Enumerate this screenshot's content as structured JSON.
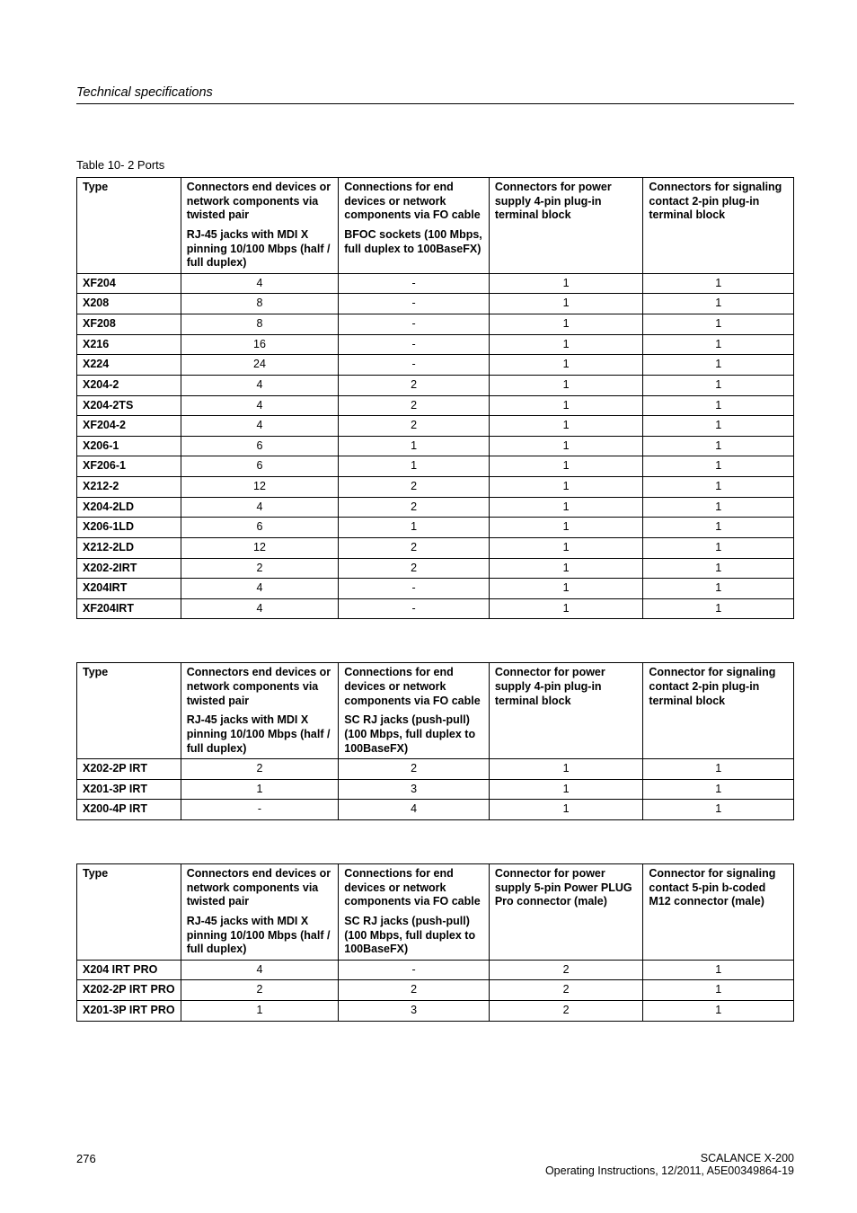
{
  "running_head": "Technical specifications",
  "caption": "Table 10- 2   Ports",
  "headers_common": {
    "type": "Type",
    "col1_top": "Connectors end devices or network components via twisted pair",
    "col1_sub": "RJ-45 jacks with MDI X pinning\n10/100 Mbps (half / full duplex)",
    "col2_top": "Connections for end devices or network components via FO cable"
  },
  "table1": {
    "col2_sub": "BFOC sockets\n(100 Mbps, full duplex to 100BaseFX)",
    "col3": "Connectors for power supply\n4-pin plug-in terminal block",
    "col4": "Connectors for signaling contact\n2-pin plug-in terminal block",
    "rows": [
      [
        "XF204",
        "4",
        "-",
        "1",
        "1"
      ],
      [
        "X208",
        "8",
        "-",
        "1",
        "1"
      ],
      [
        "XF208",
        "8",
        "-",
        "1",
        "1"
      ],
      [
        "X216",
        "16",
        "-",
        "1",
        "1"
      ],
      [
        "X224",
        "24",
        "-",
        "1",
        "1"
      ],
      [
        "X204-2",
        "4",
        "2",
        "1",
        "1"
      ],
      [
        "X204-2TS",
        "4",
        "2",
        "1",
        "1"
      ],
      [
        "XF204-2",
        "4",
        "2",
        "1",
        "1"
      ],
      [
        "X206-1",
        "6",
        "1",
        "1",
        "1"
      ],
      [
        "XF206-1",
        "6",
        "1",
        "1",
        "1"
      ],
      [
        "X212-2",
        "12",
        "2",
        "1",
        "1"
      ],
      [
        "X204-2LD",
        "4",
        "2",
        "1",
        "1"
      ],
      [
        "X206-1LD",
        "6",
        "1",
        "1",
        "1"
      ],
      [
        "X212-2LD",
        "12",
        "2",
        "1",
        "1"
      ],
      [
        "X202-2IRT",
        "2",
        "2",
        "1",
        "1"
      ],
      [
        "X204IRT",
        "4",
        "-",
        "1",
        "1"
      ],
      [
        "XF204IRT",
        "4",
        "-",
        "1",
        "1"
      ]
    ]
  },
  "table2": {
    "col2_sub": "SC RJ jacks (push-pull)\n(100 Mbps, full duplex to 100BaseFX)",
    "col3": "Connector for power supply\n4-pin plug-in terminal block",
    "col4": "Connector for signaling contact\n2-pin plug-in terminal block",
    "rows": [
      [
        "X202-2P IRT",
        "2",
        "2",
        "1",
        "1"
      ],
      [
        "X201-3P IRT",
        "1",
        "3",
        "1",
        "1"
      ],
      [
        "X200-4P IRT",
        "-",
        "4",
        "1",
        "1"
      ]
    ]
  },
  "table3": {
    "col2_sub": "SC RJ jacks (push-pull)\n(100 Mbps, full duplex to 100BaseFX)",
    "col3": "Connector for power supply\n5-pin Power PLUG Pro connector (male)",
    "col4": "Connector for signaling contact\n5-pin b-coded M12 connector (male)",
    "rows": [
      [
        "X204 IRT PRO",
        "4",
        "-",
        "2",
        "1"
      ],
      [
        "X202-2P IRT PRO",
        "2",
        "2",
        "2",
        "1"
      ],
      [
        "X201-3P IRT PRO",
        "1",
        "3",
        "2",
        "1"
      ]
    ]
  },
  "footer": {
    "page": "276",
    "line1": "SCALANCE X-200",
    "line2": "Operating Instructions, 12/2011, A5E00349864-19"
  }
}
